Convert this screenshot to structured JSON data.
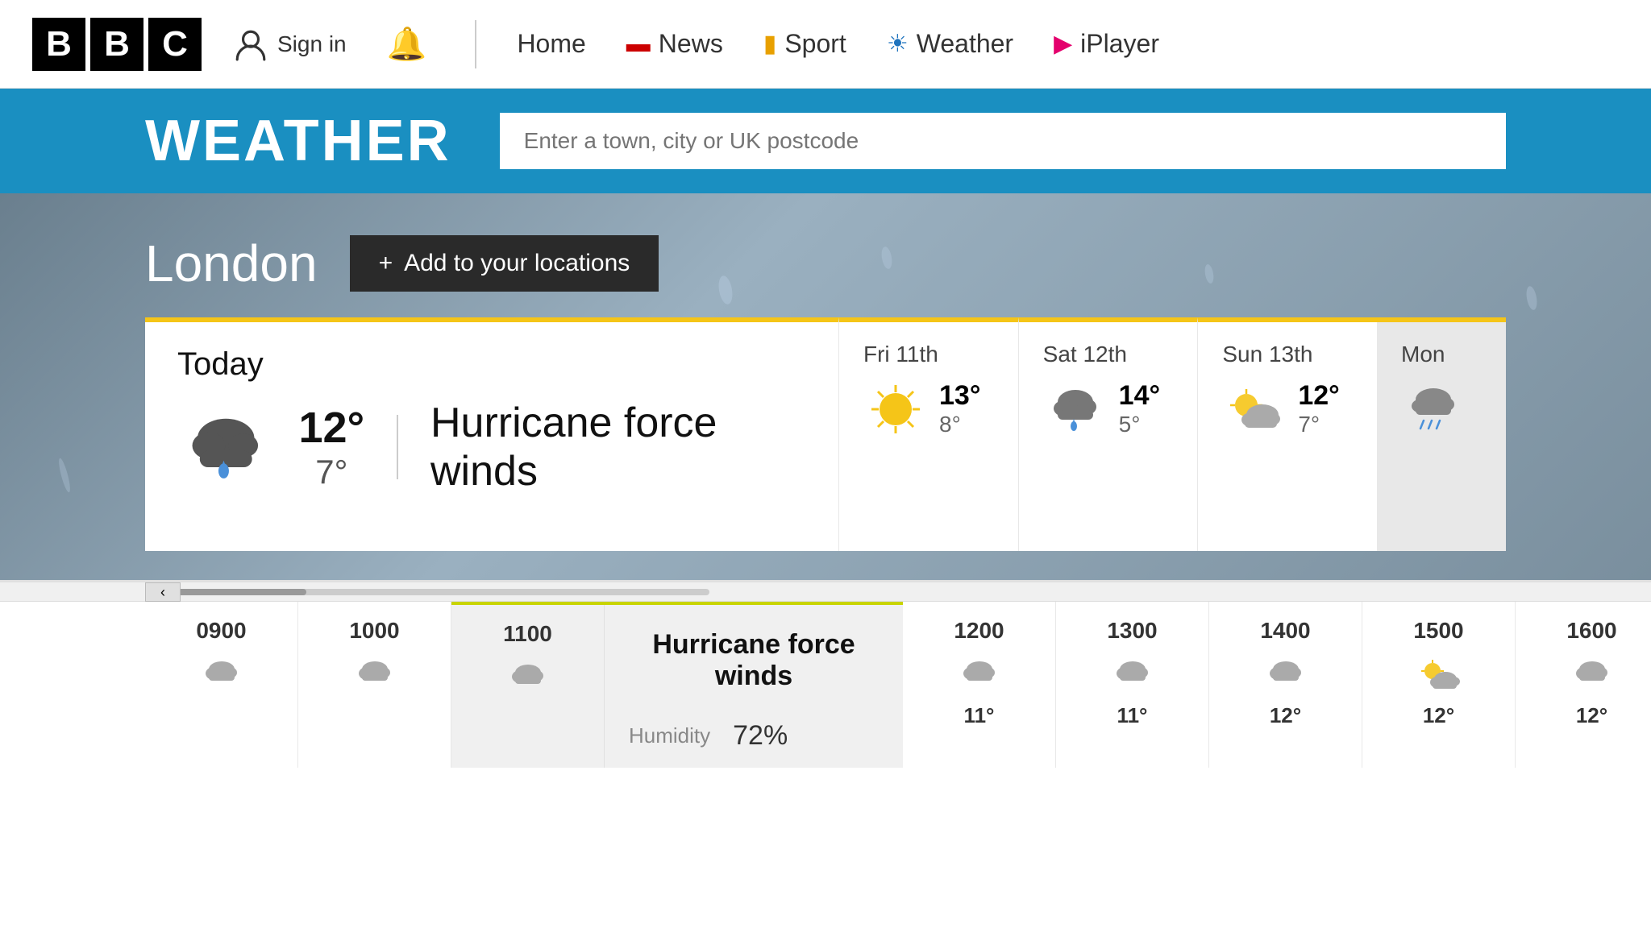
{
  "header": {
    "bbc_letters": [
      "B",
      "B",
      "C"
    ],
    "sign_in_label": "Sign in",
    "nav": [
      {
        "label": "Home",
        "icon": "home-icon",
        "color": "#333"
      },
      {
        "label": "News",
        "icon": "news-icon",
        "color": "#c00"
      },
      {
        "label": "Sport",
        "icon": "sport-icon",
        "color": "#e8a000"
      },
      {
        "label": "Weather",
        "icon": "weather-icon",
        "color": "#1e73be"
      },
      {
        "label": "iPlayer",
        "icon": "iplayer-icon",
        "color": "#e4006d"
      }
    ]
  },
  "weather_bar": {
    "title": "WEATHER",
    "search_placeholder": "Enter a town, city or UK postcode"
  },
  "location": {
    "name": "London",
    "add_button_label": "Add to your locations"
  },
  "today": {
    "label": "Today",
    "temp_high": "12°",
    "temp_low": "7°",
    "condition": "Hurricane force winds"
  },
  "forecast_days": [
    {
      "label": "Fri 11th",
      "temp_high": "13°",
      "temp_low": "8°",
      "icon": "sun"
    },
    {
      "label": "Sat 12th",
      "temp_high": "14°",
      "temp_low": "5°",
      "icon": "cloud-rain"
    },
    {
      "label": "Sun 13th",
      "temp_high": "12°",
      "temp_low": "7°",
      "icon": "partly-cloudy"
    },
    {
      "label": "Mon",
      "temp_high": "",
      "temp_low": "",
      "icon": "cloud-rain-heavy"
    }
  ],
  "hourly": {
    "scroll_label": "‹",
    "hours": [
      {
        "label": "0900",
        "icon": "cloud",
        "temp": null
      },
      {
        "label": "1000",
        "icon": "cloud",
        "temp": null
      },
      {
        "label": "1100",
        "icon": "cloud",
        "temp": null,
        "highlighted": true
      },
      {
        "label": "1200",
        "icon": "cloud",
        "temp": "11°"
      },
      {
        "label": "1300",
        "icon": "cloud",
        "temp": "11°"
      },
      {
        "label": "1400",
        "icon": "cloud",
        "temp": "12°"
      },
      {
        "label": "1500",
        "icon": "partly-cloudy-sun",
        "temp": "12°"
      },
      {
        "label": "1600",
        "icon": "cloud",
        "temp": "12°"
      }
    ],
    "hurricane_label": "Hurricane force winds",
    "humidity_label": "Humidity",
    "humidity_value": "72%"
  }
}
